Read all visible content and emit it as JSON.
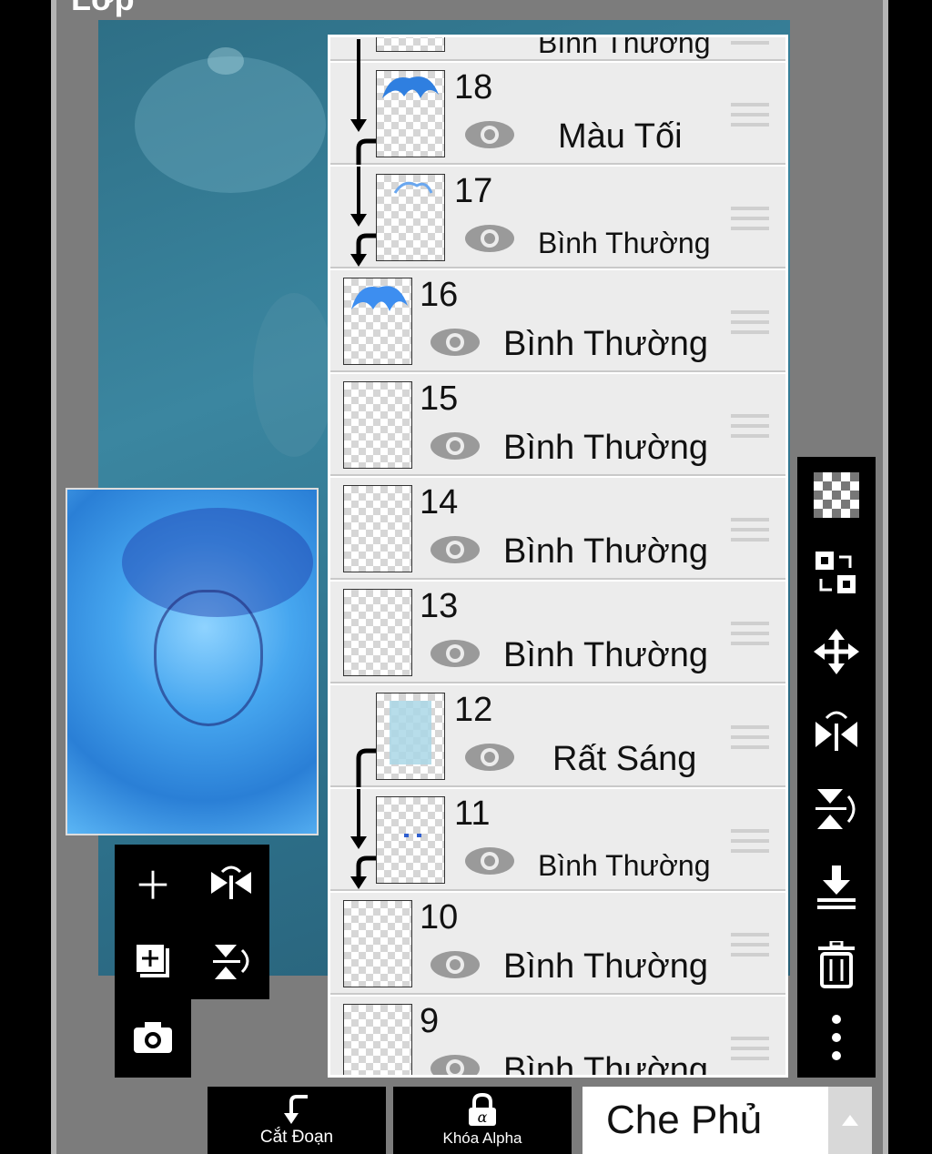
{
  "panel_title": "Lớp",
  "layers": [
    {
      "number": "",
      "mode": "Bình Thường",
      "partial": true
    },
    {
      "number": "18",
      "mode": "Màu Tối",
      "clipped": true
    },
    {
      "number": "17",
      "mode": "Bình Thường",
      "clipped": true
    },
    {
      "number": "16",
      "mode": "Bình Thường",
      "clipped": false
    },
    {
      "number": "15",
      "mode": "Bình Thường",
      "clipped": false
    },
    {
      "number": "14",
      "mode": "Bình Thường",
      "clipped": false
    },
    {
      "number": "13",
      "mode": "Bình Thường",
      "clipped": false
    },
    {
      "number": "12",
      "mode": "Rất Sáng",
      "clipped": true
    },
    {
      "number": "11",
      "mode": "Bình Thường",
      "clipped": true
    },
    {
      "number": "10",
      "mode": "Bình Thường",
      "clipped": false
    },
    {
      "number": "9",
      "mode": "Bình Thường",
      "clipped": false
    }
  ],
  "bottom_bar": {
    "clip_label": "Cắt Đoạn",
    "alpha_lock_label": "Khóa Alpha",
    "blend_mode": "Che Phủ"
  },
  "left_tools": [
    "add-layer-icon",
    "flip-horizontal-icon",
    "add-copy-icon",
    "flip-vertical-icon",
    "camera-icon"
  ],
  "right_tools": [
    "transparency-icon",
    "swap-layers-icon",
    "move-icon",
    "flip-horizontal-icon",
    "flip-vertical-icon",
    "merge-down-icon",
    "trash-icon",
    "more-icon"
  ],
  "colors": {
    "panel_bg": "#ececec",
    "frame": "#7c7c7c",
    "accent_dark": "#000000"
  }
}
